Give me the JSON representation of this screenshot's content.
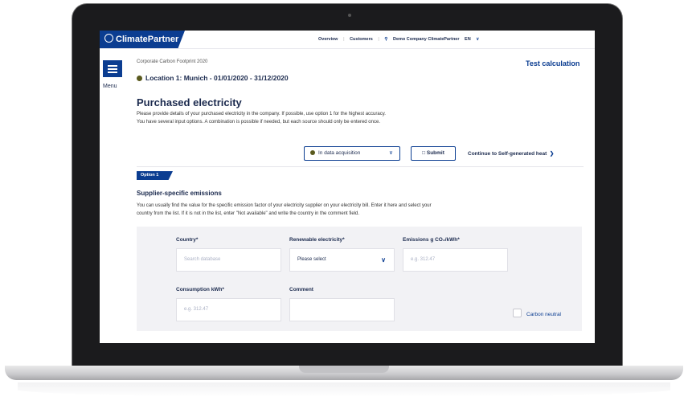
{
  "brand": {
    "name": "ClimatePartner",
    "accent": "#0b3d91"
  },
  "topnav": {
    "overview": "Overview",
    "customers": "Customers",
    "user": "Demo Company ClimatePartner",
    "language": "EN"
  },
  "sidebar": {
    "menu_label": "Menu"
  },
  "header": {
    "breadcrumb": "Corporate Carbon Footprint 2020",
    "test_calc": "Test calculation",
    "location": "Location 1: Munich - 01/01/2020 - 31/12/2020"
  },
  "section": {
    "title": "Purchased electricity",
    "desc_line1": "Please provide details of your purchased electricity in the company. If possible, use option 1 for the highest accuracy.",
    "desc_line2": "You have several input options. A combination is possible if needed, but each source should only be entered once."
  },
  "actions": {
    "status": "In data acquisition",
    "submit": "Submit",
    "continue": "Continue to Self-generated heat"
  },
  "option": {
    "tag": "Option 1",
    "title": "Supplier-specific emissions",
    "body_line1": "You can usually find the value for the specific emission factor of your electricity supplier on your electricity bill. Enter it here and select your",
    "body_line2": "country from the list. If it is not in the list, enter \"Not available\" and write the country in the comment field."
  },
  "form": {
    "country_label": "Country*",
    "country_placeholder": "Search database",
    "renewable_label": "Renewable electricity*",
    "renewable_value": "Please select",
    "emissions_label": "Emissions g CO₂/kWh*",
    "emissions_placeholder": "e.g. 312.47",
    "consumption_label": "Consumption kWh*",
    "consumption_placeholder": "e.g. 312.47",
    "comment_label": "Comment",
    "carbon_neutral_label": "Carbon neutral"
  }
}
